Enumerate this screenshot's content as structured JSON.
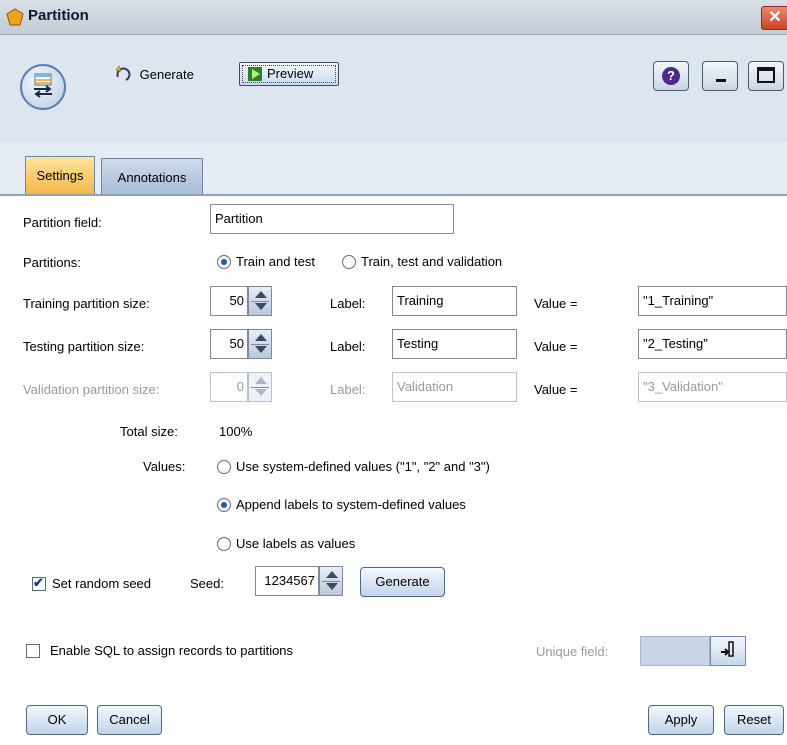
{
  "window": {
    "title": "Partition",
    "close_glyph": "✕"
  },
  "toolbar": {
    "generate_label": "Generate",
    "preview_label": "Preview",
    "help_glyph": "?"
  },
  "tabs": [
    {
      "label": "Settings",
      "active": true
    },
    {
      "label": "Annotations",
      "active": false
    }
  ],
  "partition_field": {
    "label": "Partition field:",
    "value": "Partition"
  },
  "partitions": {
    "label": "Partitions:",
    "options": [
      {
        "label": "Train and test",
        "selected": true
      },
      {
        "label": "Train, test and validation",
        "selected": false
      }
    ]
  },
  "rows": [
    {
      "label": "Training partition size:",
      "size": "50",
      "label_caption": "Label:",
      "label_value": "Training",
      "value_caption": "Value =",
      "value": "\"1_Training\"",
      "enabled": true
    },
    {
      "label": "Testing partition size:",
      "size": "50",
      "label_caption": "Label:",
      "label_value": "Testing",
      "value_caption": "Value =",
      "value": "\"2_Testing\"",
      "enabled": true
    },
    {
      "label": "Validation partition size:",
      "size": "0",
      "label_caption": "Label:",
      "label_value": "Validation",
      "value_caption": "Value =",
      "value": "\"3_Validation\"",
      "enabled": false
    }
  ],
  "total": {
    "label": "Total size:",
    "value": "100%"
  },
  "values": {
    "label": "Values:",
    "options": [
      {
        "label": "Use system-defined values (\"1\", \"2\" and \"3\")",
        "selected": false
      },
      {
        "label": "Append labels to system-defined values",
        "selected": true
      },
      {
        "label": "Use labels as values",
        "selected": false
      }
    ]
  },
  "seed": {
    "checkbox_label": "Set random seed",
    "checked": true,
    "seed_label": "Seed:",
    "seed_value": "1234567",
    "generate_button": "Generate"
  },
  "sql": {
    "checkbox_label": "Enable SQL to assign records to partitions",
    "checked": false,
    "unique_field_label": "Unique field:"
  },
  "footer": {
    "ok": "OK",
    "cancel": "Cancel",
    "apply": "Apply",
    "reset": "Reset"
  }
}
